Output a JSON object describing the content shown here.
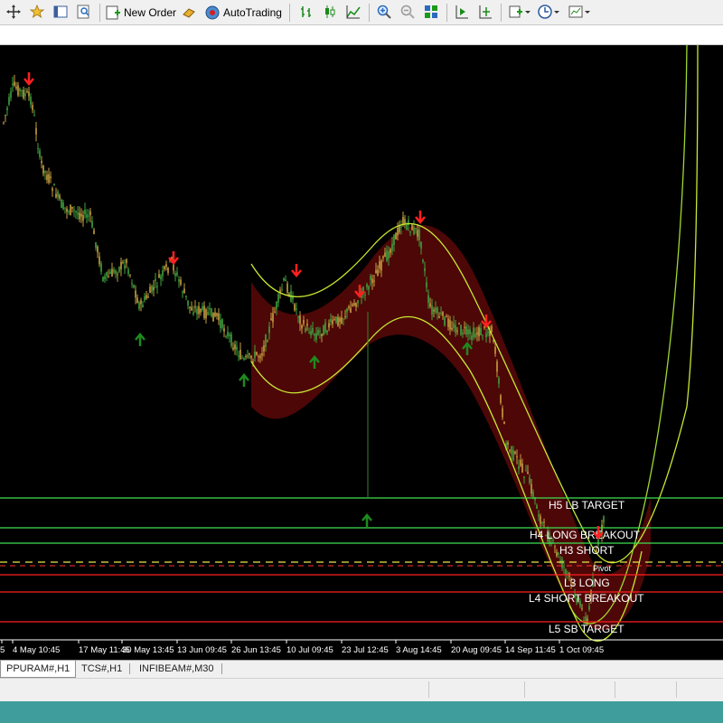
{
  "toolbar": {
    "new_order_label": "New Order",
    "autotrading_label": "AutoTrading"
  },
  "chart": {
    "levels": [
      {
        "label": "H5 LB TARGET",
        "color": "#3fe04f"
      },
      {
        "label": "H4 LONG BREAKOUT",
        "color": "#3fe04f"
      },
      {
        "label": "H3 SHORT",
        "color": "#3fe04f"
      },
      {
        "label": "Pivot",
        "color": "#e8e84a"
      },
      {
        "label": "L3 LONG",
        "color": "#ff2020"
      },
      {
        "label": "L4 SHORT BREAKOUT",
        "color": "#ff2020"
      },
      {
        "label": "L5 SB TARGET",
        "color": "#ff2020"
      }
    ],
    "time_labels": [
      "5",
      "4 May 10:45",
      "17 May 11:45",
      "30 May 13:45",
      "13 Jun 09:45",
      "26 Jun 13:45",
      "10 Jul 09:45",
      "23 Jul 12:45",
      "3 Aug 14:45",
      "20 Aug 09:45",
      "14 Sep 11:45",
      "1 Oct 09:45"
    ]
  },
  "tabs": [
    {
      "label": "PPURAM#,H1",
      "active": true
    },
    {
      "label": "TCS#,H1",
      "active": false
    },
    {
      "label": "INFIBEAM#,M30",
      "active": false
    }
  ]
}
